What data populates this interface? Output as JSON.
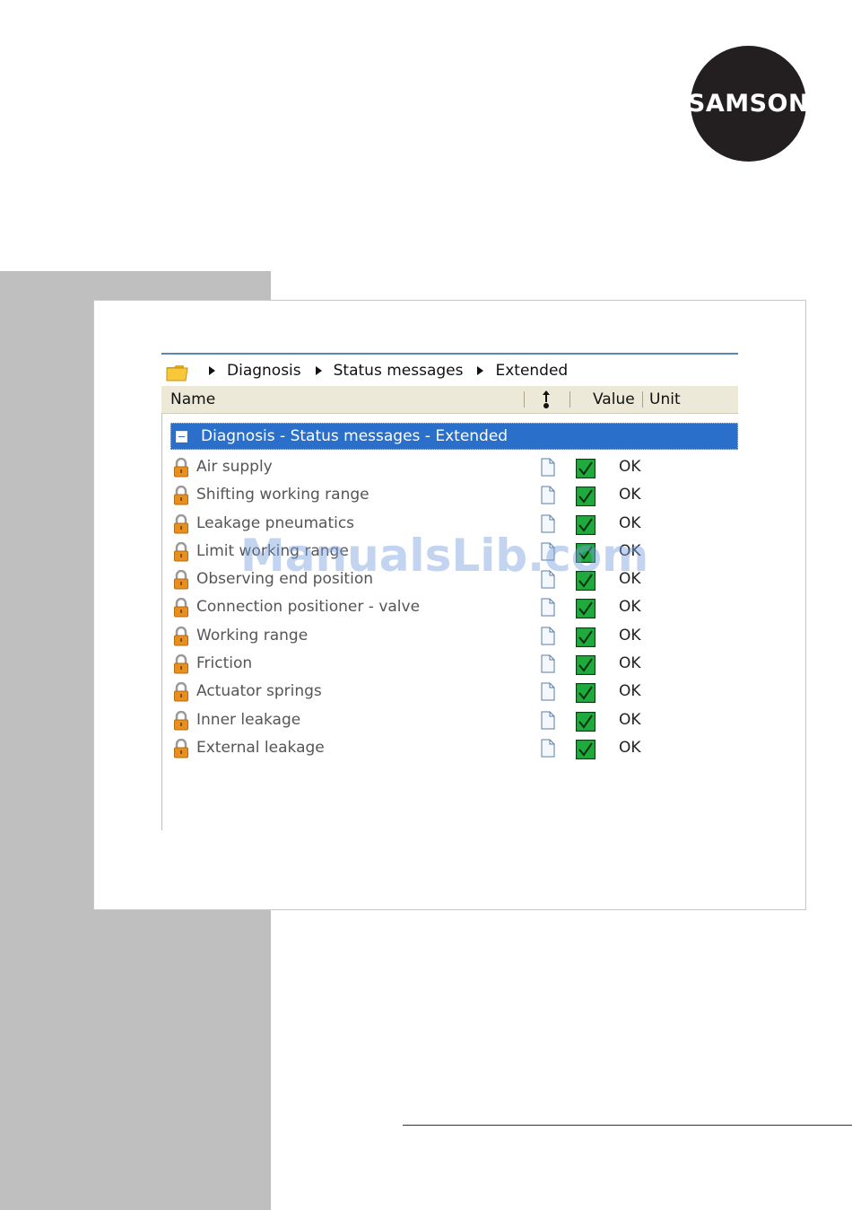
{
  "brand": {
    "logo_text": "SAMSON"
  },
  "breadcrumb": [
    "Diagnosis",
    "Status messages",
    "Extended"
  ],
  "table": {
    "headers": {
      "name": "Name",
      "value": "Value",
      "unit": "Unit"
    },
    "group": {
      "label": "Diagnosis - Status messages - Extended",
      "expanded": true
    },
    "rows": [
      {
        "name": "Air supply",
        "value": "OK"
      },
      {
        "name": "Shifting working range",
        "value": "OK"
      },
      {
        "name": "Leakage pneumatics",
        "value": "OK"
      },
      {
        "name": "Limit working range",
        "value": "OK"
      },
      {
        "name": "Observing end position",
        "value": "OK"
      },
      {
        "name": "Connection positioner - valve",
        "value": "OK"
      },
      {
        "name": "Working range",
        "value": "OK"
      },
      {
        "name": "Friction",
        "value": "OK"
      },
      {
        "name": "Actuator springs",
        "value": "OK"
      },
      {
        "name": "Inner leakage",
        "value": "OK"
      },
      {
        "name": "External leakage",
        "value": "OK"
      }
    ]
  },
  "watermark": "ManualsLib.com",
  "colors": {
    "selection": "#2a6fc9",
    "header_bg": "#ece9d8",
    "check_green": "#1faa3c",
    "lock_orange": "#e8901f",
    "side_band": "#bfbfbf"
  },
  "icons": {
    "folder": "folder-icon",
    "lock": "lock-icon",
    "document": "document-icon",
    "check": "checkbox-checked-icon",
    "sort": "sort-arrows-icon",
    "collapse": "minus-icon"
  }
}
